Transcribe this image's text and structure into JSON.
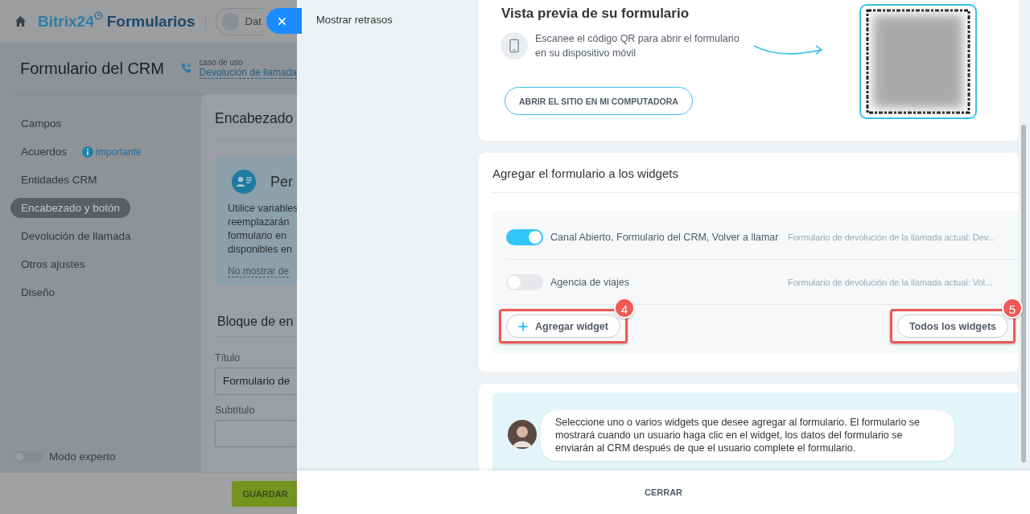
{
  "background_page": {
    "header": {
      "logo": "Bitrix24",
      "logo_suffix": "Formularios",
      "chip": "Dat"
    },
    "title": "Formulario del CRM",
    "use_case": {
      "label": "caso de uso",
      "link": "Devolución de llamada"
    },
    "menu": [
      {
        "label": "Campos",
        "selected": false
      },
      {
        "label": "Acuerdos",
        "selected": false,
        "badge": "importante"
      },
      {
        "label": "Entidades CRM",
        "selected": false
      },
      {
        "label": "Encabezado y botón",
        "selected": true
      },
      {
        "label": "Devolución de llamada",
        "selected": false
      },
      {
        "label": "Otros ajustes",
        "selected": false
      },
      {
        "label": "Diseño",
        "selected": false
      }
    ],
    "expert_mode": {
      "label": "Modo experto",
      "on": false
    },
    "content": {
      "heading": "Encabezado",
      "info": {
        "title": "Per",
        "lines": [
          "Utilice variables",
          "reemplazarán",
          "formulario en",
          "disponibles en"
        ],
        "link": "No mostrar de"
      },
      "block_heading": "Bloque de en",
      "fields": [
        {
          "label": "Título",
          "value": "Formulario de"
        },
        {
          "label": "Subtítulo"
        }
      ]
    },
    "save_button": "GUARDAR"
  },
  "slider": {
    "nav": [
      {
        "label": "Mostrar retrasos"
      }
    ],
    "preview": {
      "title": "Vista previa de su formulario",
      "text": "Escanee el código QR para abrir el formulario en su dispositivo móvil",
      "button": "ABRIR EL SITIO EN MI COMPUTADORA"
    },
    "widgets": {
      "title": "Agregar el formulario a los widgets",
      "rows": [
        {
          "name": "Canal Abierto, Formulario del CRM, Volver a llamar",
          "detail": "Formulario de devolución de la llamada actual: Dev...",
          "on": true
        },
        {
          "name": "Agencia de viajes",
          "detail": "Formulario de devolución de la llamada actual: Vol...",
          "on": false
        }
      ],
      "add_button": {
        "label": "Agregar widget",
        "annotation": "4"
      },
      "all_button": {
        "label": "Todos los widgets",
        "annotation": "5"
      }
    },
    "hint": {
      "text": "Seleccione uno o varios widgets que desee agregar al formulario. El formulario se mostrará cuando un usuario haga clic en el widget, los datos del formulario se enviarán al CRM después de que el usuario complete el formulario."
    },
    "footer_button": "CERRAR"
  }
}
